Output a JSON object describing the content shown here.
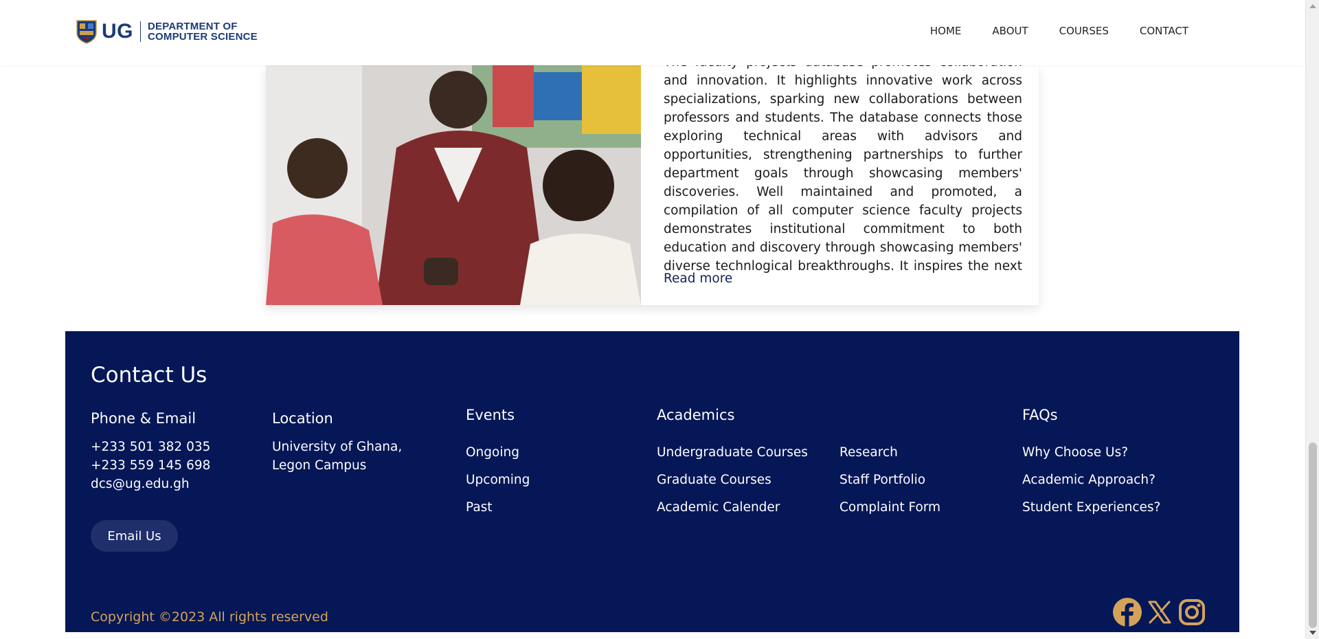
{
  "header": {
    "logo_mark": "UG",
    "logo_line1": "DEPARTMENT OF",
    "logo_line2": "COMPUTER SCIENCE",
    "nav": [
      {
        "label": "HOME"
      },
      {
        "label": "ABOUT"
      },
      {
        "label": "COURSES"
      },
      {
        "label": "CONTACT"
      }
    ]
  },
  "article": {
    "body": "The faculty projects database promotes collaboration and innovation. It highlights innovative work across specializations, sparking new collaborations between professors and students. The database connects those exploring technical areas with advisors and opportunities, strengthening partnerships to further department goals through showcasing members' discoveries. Well maintained and promoted, a compilation of all computer science faculty projects demonstrates institutional commitment to both education and discovery through showcasing members' diverse technlogical breakthroughs. It inspires the next generation of scholars and innovators.",
    "read_more": "Read more"
  },
  "footer": {
    "title": "Contact Us",
    "phone_email": {
      "heading": "Phone & Email",
      "phone1": "+233 501 382 035",
      "phone2": "+233 559 145 698",
      "email": "dcs@ug.edu.gh",
      "button": "Email Us"
    },
    "location": {
      "heading": "Location",
      "line1": "University of Ghana,",
      "line2": "Legon Campus"
    },
    "events": {
      "heading": "Events",
      "links": [
        "Ongoing",
        "Upcoming",
        "Past"
      ]
    },
    "academics": {
      "heading": "Academics",
      "links_left": [
        "Undergraduate Courses",
        "Graduate Courses",
        "Academic Calender"
      ],
      "links_right": [
        "Research",
        "Staff Portfolio",
        "Complaint Form"
      ]
    },
    "faqs": {
      "heading": "FAQs",
      "links": [
        "Why Choose Us?",
        "Academic Approach?",
        "Student Experiences?"
      ]
    },
    "copyright": "Copyright ©2023 All rights reserved",
    "social_icons": [
      "facebook-icon",
      "x-icon",
      "instagram-icon"
    ]
  },
  "colors": {
    "navy": "#051756",
    "accent_gold": "#d4a35b",
    "button": "#1e2f6b",
    "logo_blue": "#1b3a7a"
  }
}
